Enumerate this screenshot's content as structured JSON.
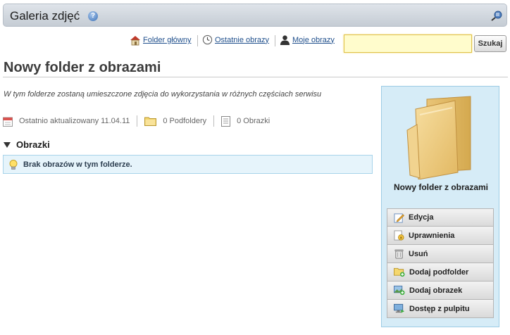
{
  "header": {
    "title": "Galeria zdjęć",
    "help_glyph": "?"
  },
  "toolbar": {
    "links": [
      {
        "label": "Folder główny",
        "icon": "home-icon"
      },
      {
        "label": "Ostatnie obrazy",
        "icon": "clock-icon"
      },
      {
        "label": "Moje obrazy",
        "icon": "user-icon"
      }
    ],
    "search": {
      "value": "",
      "placeholder": "",
      "button_label": "Szukaj"
    }
  },
  "page": {
    "title": "Nowy folder z obrazami",
    "description": "W tym folderze zostaną umieszczone zdjęcia do wykorzystania w różnych częściach serwisu",
    "meta": {
      "updated": "Ostatnio aktualizowany 11.04.11",
      "subfolders": "0 Podfoldery",
      "images": "0 Obrazki"
    },
    "section_title": "Obrazki",
    "empty_message": "Brak obrazów w tym folderze."
  },
  "side_panel": {
    "folder_name": "Nowy folder z obrazami",
    "actions": [
      {
        "label": "Edycja",
        "icon": "edit-icon"
      },
      {
        "label": "Uprawnienia",
        "icon": "permissions-icon"
      },
      {
        "label": "Usuń",
        "icon": "trash-icon"
      },
      {
        "label": "Dodaj podfolder",
        "icon": "add-folder-icon"
      },
      {
        "label": "Dodaj obrazek",
        "icon": "add-image-icon"
      },
      {
        "label": "Dostęp z pulpitu",
        "icon": "desktop-icon"
      }
    ]
  },
  "colors": {
    "accent_link": "#1f4f8c",
    "panel_bg": "#d6ecf7",
    "info_bg": "#e6f4fb",
    "search_bg": "#fffccc"
  }
}
